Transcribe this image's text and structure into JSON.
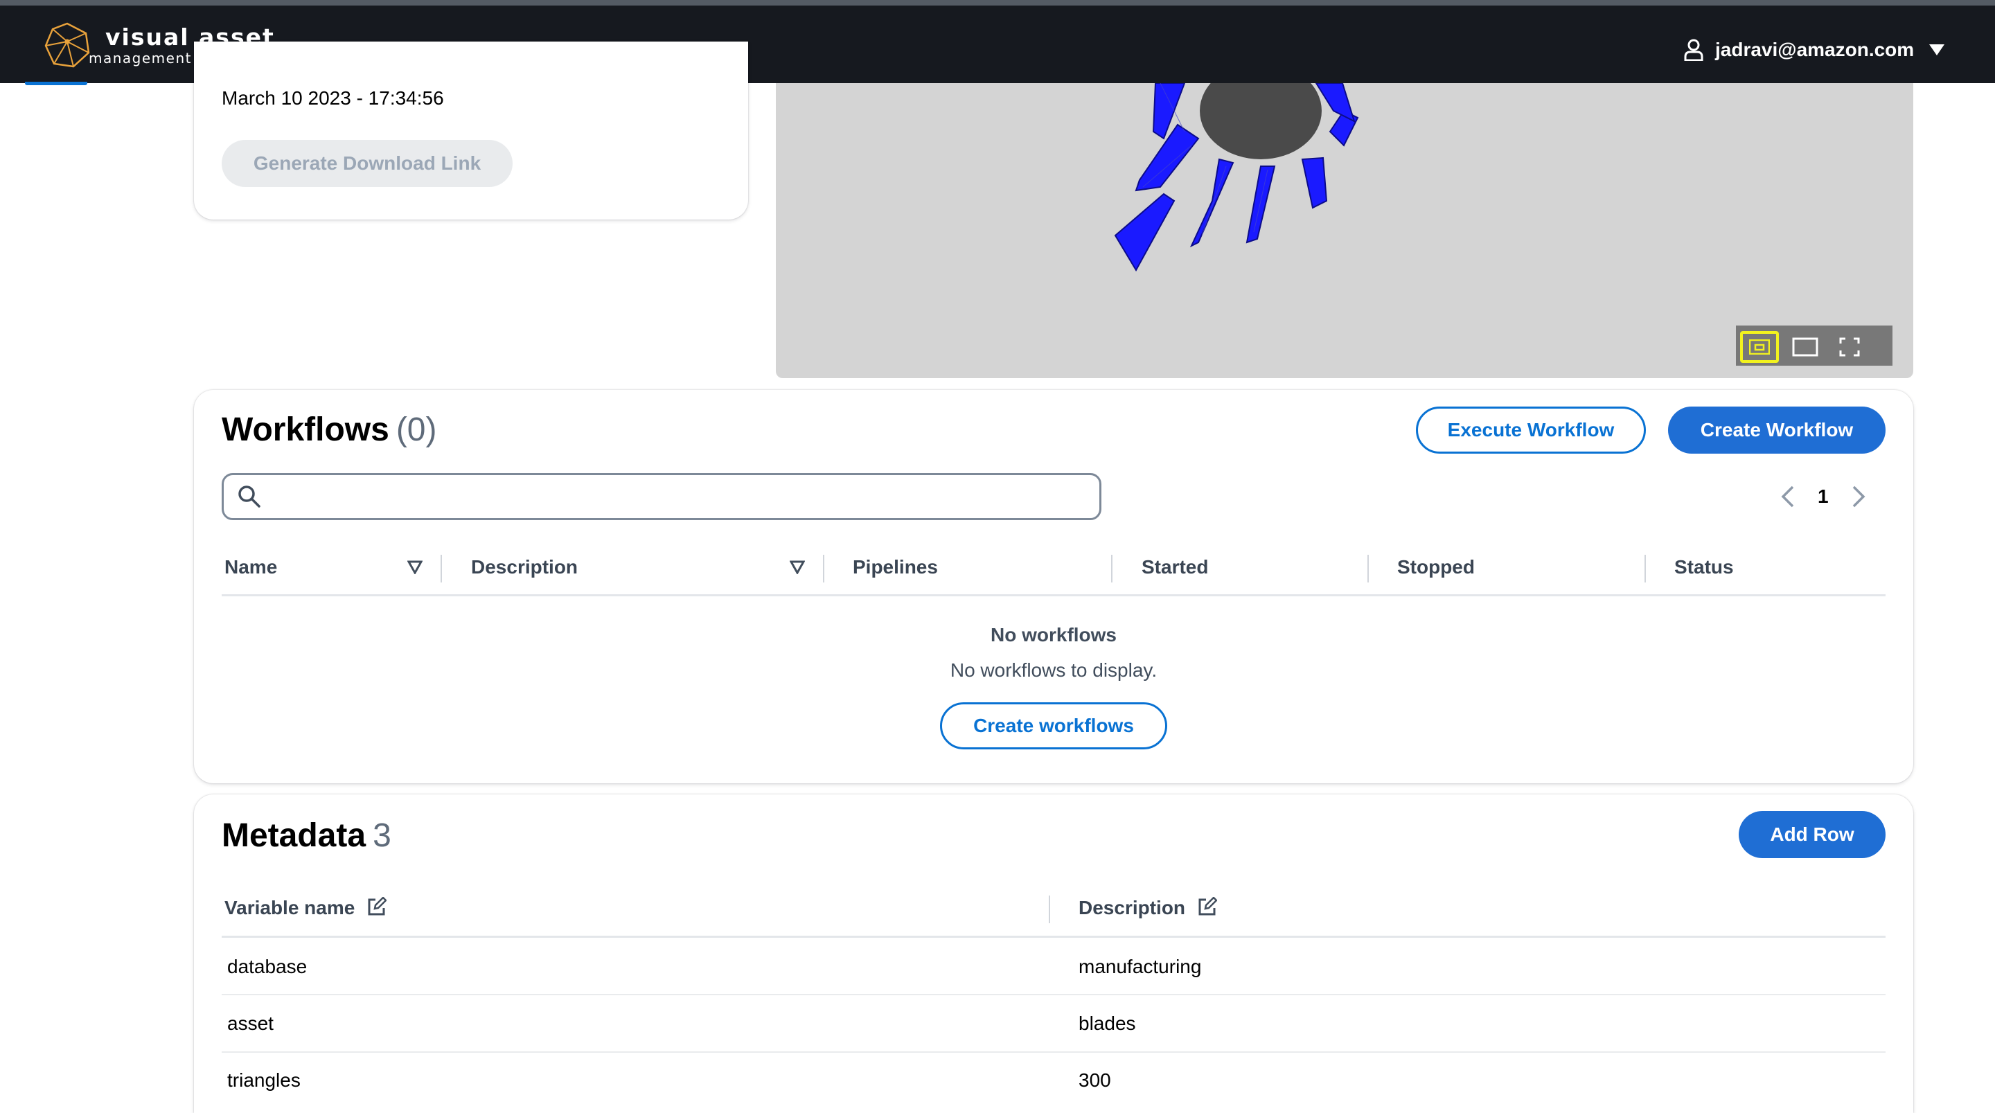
{
  "header": {
    "brand_line1": "visual asset",
    "brand_line2": "management system",
    "user_email": "jadravi@amazon.com"
  },
  "file_card": {
    "date": "March 10 2023 - 17:34:56",
    "download_button": "Generate Download Link"
  },
  "viewer": {
    "toolbar": [
      "view-mode-small-icon",
      "view-mode-wide-icon",
      "fullscreen-icon"
    ],
    "selected_index": 0
  },
  "workflows": {
    "title": "Workflows",
    "count": "(0)",
    "execute_button": "Execute Workflow",
    "create_button": "Create Workflow",
    "search_value": "",
    "page": "1",
    "columns": [
      "Name",
      "Description",
      "Pipelines",
      "Started",
      "Stopped",
      "Status"
    ],
    "empty_title": "No workflows",
    "empty_text": "No workflows to display.",
    "empty_button": "Create workflows"
  },
  "metadata": {
    "title": "Metadata",
    "count": "3",
    "add_button": "Add Row",
    "columns": [
      "Variable name",
      "Description"
    ],
    "rows": [
      {
        "name": "database",
        "description": "manufacturing"
      },
      {
        "name": "asset",
        "description": "blades"
      },
      {
        "name": "triangles",
        "description": "300"
      }
    ]
  },
  "colors": {
    "navbar": "#16191f",
    "primary": "#1f6ed4",
    "link_blue": "#0972d3",
    "model_blue": "#1a1aff",
    "viewer_bg": "#d4d4d4"
  }
}
